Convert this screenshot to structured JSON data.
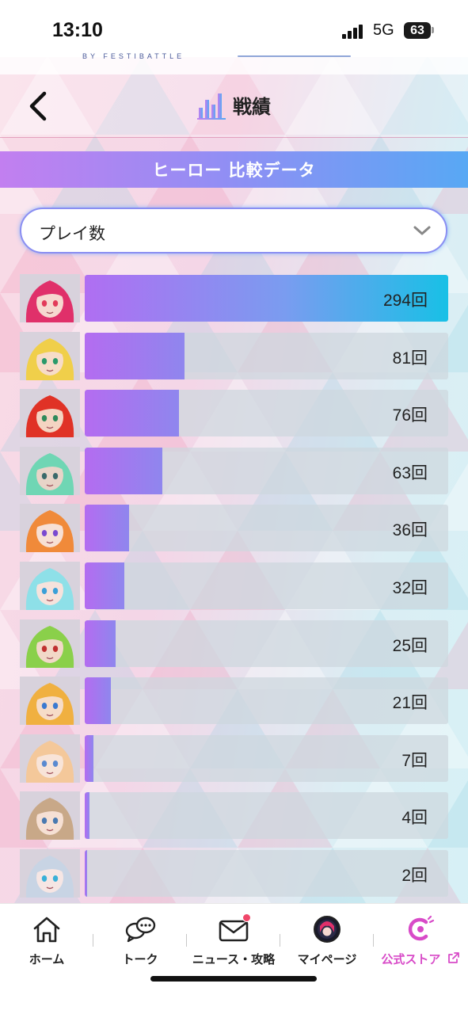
{
  "status_bar": {
    "time": "13:10",
    "network": "5G",
    "battery": "63"
  },
  "header": {
    "brand_subtitle": "BY FESTIBATTLE",
    "title": "戦績"
  },
  "section": {
    "title": "ヒーロー 比較データ"
  },
  "filter": {
    "selected": "プレイ数"
  },
  "colors": {
    "accent_purple": "#b46cf0",
    "accent_blue": "#18c0e6",
    "store_pink": "#d84bc8",
    "badge_red": "#f0476a"
  },
  "max_value": 294,
  "rankings": [
    {
      "value": 294,
      "label": "294回",
      "hair": "#e0306a",
      "skin": "#f6d8d0",
      "eye": "#e23a5a"
    },
    {
      "value": 81,
      "label": "81回",
      "hair": "#f0cf4a",
      "skin": "#f7dcc8",
      "eye": "#2a9a6a"
    },
    {
      "value": 76,
      "label": "76回",
      "hair": "#e03226",
      "skin": "#f4d4c2",
      "eye": "#2f8a5a"
    },
    {
      "value": 63,
      "label": "63回",
      "hair": "#6fd6b4",
      "skin": "#e8d4c8",
      "eye": "#3a6a6a"
    },
    {
      "value": 36,
      "label": "36回",
      "hair": "#f08a3a",
      "skin": "#f7e0d4",
      "eye": "#7a4ad0"
    },
    {
      "value": 32,
      "label": "32回",
      "hair": "#8ee0e8",
      "skin": "#f6e2dc",
      "eye": "#3aa0d8"
    },
    {
      "value": 25,
      "label": "25回",
      "hair": "#8ad04a",
      "skin": "#f2d8c8",
      "eye": "#c03030"
    },
    {
      "value": 21,
      "label": "21回",
      "hair": "#f0b040",
      "skin": "#f6dcc8",
      "eye": "#3a7ad0"
    },
    {
      "value": 7,
      "label": "7回",
      "hair": "#f4c89a",
      "skin": "#f8e4d8",
      "eye": "#5a8ad0"
    },
    {
      "value": 4,
      "label": "4回",
      "hair": "#c8a888",
      "skin": "#f6e0d4",
      "eye": "#4a7ab0"
    },
    {
      "value": 2,
      "label": "2回",
      "hair": "#c8d4e4",
      "skin": "#f6e6e4",
      "eye": "#3ab0d8"
    }
  ],
  "bottom_nav": [
    {
      "label": "ホーム",
      "icon": "home-icon"
    },
    {
      "label": "トーク",
      "icon": "chat-icon"
    },
    {
      "label": "ニュース・攻略",
      "icon": "mail-icon"
    },
    {
      "label": "マイページ",
      "icon": "avatar-icon"
    },
    {
      "label": "公式ストア",
      "icon": "store-icon"
    }
  ]
}
